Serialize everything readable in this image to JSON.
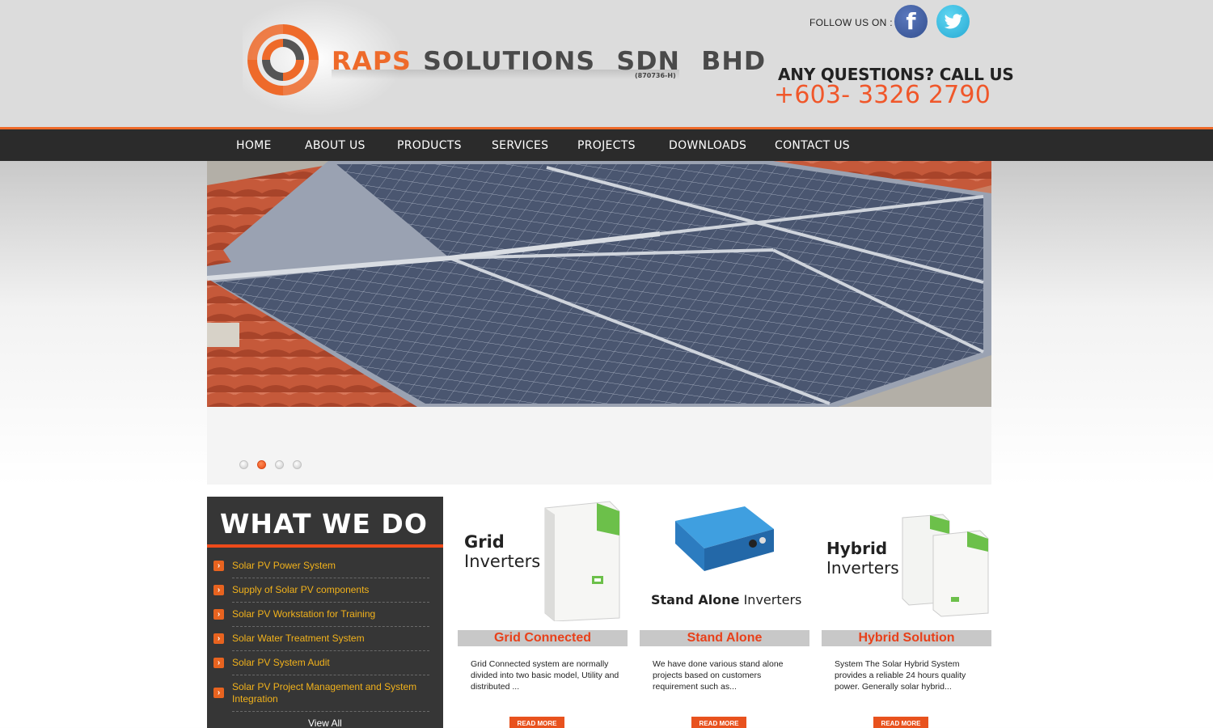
{
  "header": {
    "brand_primary": "RAPS",
    "brand_secondary": "SOLUTIONS SDN BHD",
    "registration": "(870736-H)",
    "follow_label": "FOLLOW US ON :",
    "social": [
      {
        "icon": "facebook-icon",
        "glyph": "f"
      },
      {
        "icon": "twitter-icon"
      }
    ],
    "questions": "ANY QUESTIONS? CALL US",
    "phone": "+603- 3326 2790"
  },
  "nav": {
    "items": [
      "HOME",
      "ABOUT US",
      "PRODUCTS",
      "SERVICES",
      "PROJECTS",
      "DOWNLOADS",
      "CONTACT US"
    ]
  },
  "slider": {
    "slide_count": 4,
    "active_slide": 2
  },
  "what_we_do": {
    "title": "WHAT WE DO",
    "items": [
      "Solar PV Power System",
      "Supply of Solar PV components",
      "Solar PV Workstation for Training",
      "Solar Water Treatment System",
      "Solar PV System Audit",
      "Solar PV Project Management and System Integration"
    ],
    "view_all": "View All"
  },
  "products": [
    {
      "image_label_line1": "Grid",
      "image_label_line2": "Inverters",
      "heading": "Grid Connected",
      "description": "Grid Connected system are normally divided into two basic model, Utility and distributed ...",
      "read_more": "READ MORE"
    },
    {
      "image_label_line1": "Stand Alone",
      "image_label_line2": "Inverters",
      "heading": "Stand Alone",
      "description": "We have done various stand alone projects based on customers requirement such as...",
      "read_more": "READ MORE"
    },
    {
      "image_label_line1": "Hybrid",
      "image_label_line2": "Inverters",
      "heading": "Hybrid Solution",
      "description": "System The Solar Hybrid System provides a reliable 24 hours quality power. Generally solar hybrid...",
      "read_more": "READ MORE"
    }
  ],
  "colors": {
    "accent": "#ee6a2a",
    "nav_bg": "#2b2b2b",
    "link_yellow": "#f2b21b",
    "heading_red": "#e8401a"
  }
}
